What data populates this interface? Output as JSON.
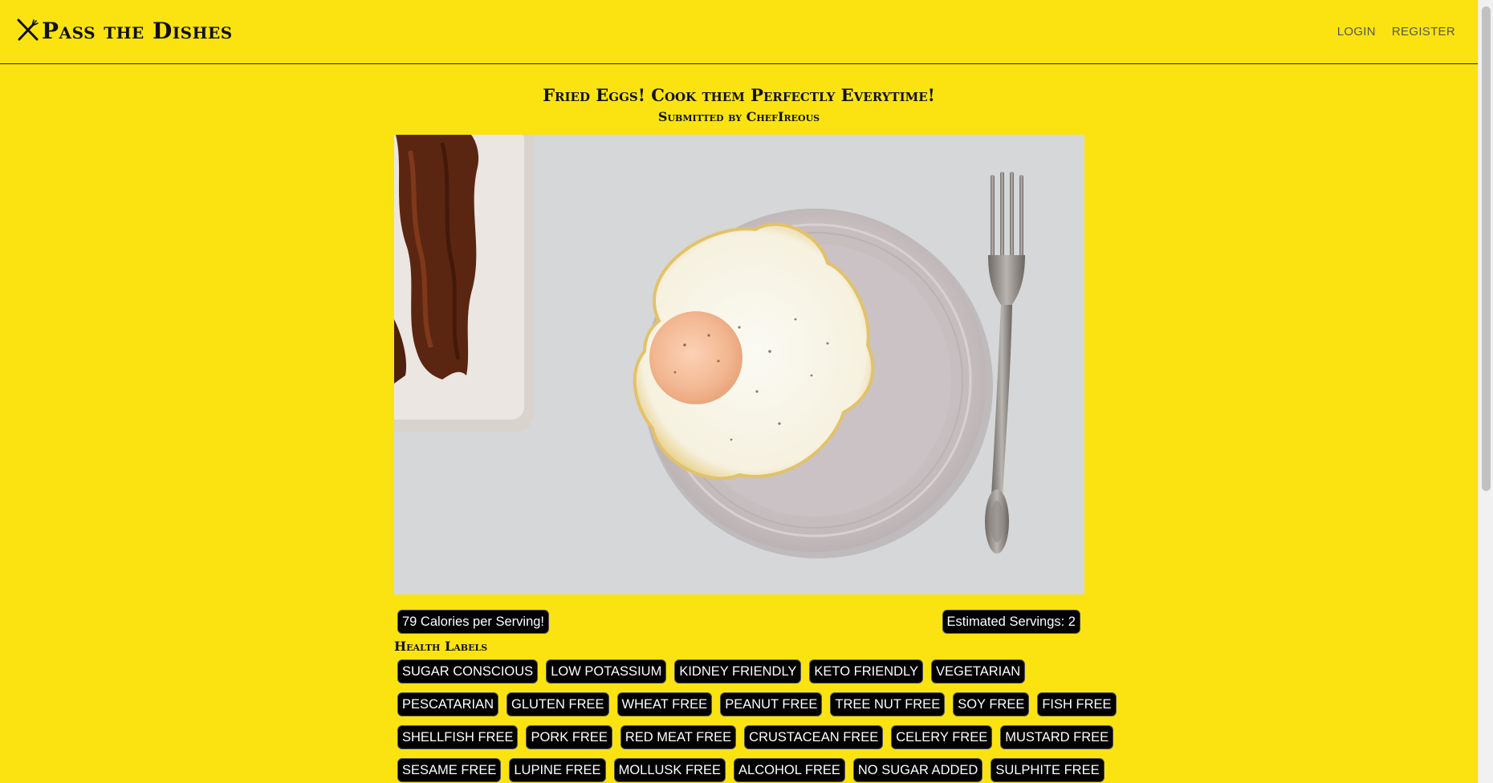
{
  "navbar": {
    "brand": "Pass the Dishes",
    "login": "LOGIN",
    "register": "REGISTER"
  },
  "recipe": {
    "title": "Fried Eggs! Cook them Perfectly Everytime!",
    "author": "Submitted by ChefIreous",
    "calories": "79 Calories per Serving!",
    "servings": "Estimated Servings: 2",
    "health_heading": "Health Labels",
    "health_labels": [
      [
        "SUGAR CONSCIOUS",
        "LOW POTASSIUM",
        "KIDNEY FRIENDLY",
        "KETO FRIENDLY",
        "VEGETARIAN"
      ],
      [
        "PESCATARIAN",
        "GLUTEN FREE",
        "WHEAT FREE",
        "PEANUT FREE",
        "TREE NUT FREE",
        "SOY FREE",
        "FISH FREE"
      ],
      [
        "SHELLFISH FREE",
        "PORK FREE",
        "RED MEAT FREE",
        "CRUSTACEAN FREE",
        "CELERY FREE",
        "MUSTARD FREE"
      ],
      [
        "SESAME FREE",
        "LUPINE FREE",
        "MOLLUSK FREE",
        "ALCOHOL FREE",
        "NO SUGAR ADDED",
        "SULPHITE FREE"
      ]
    ]
  },
  "colors": {
    "background": "#fae311",
    "pill": "#000000",
    "pill_text": "#ffffff"
  },
  "icons": {
    "brand": "crossed-utensils-icon"
  }
}
